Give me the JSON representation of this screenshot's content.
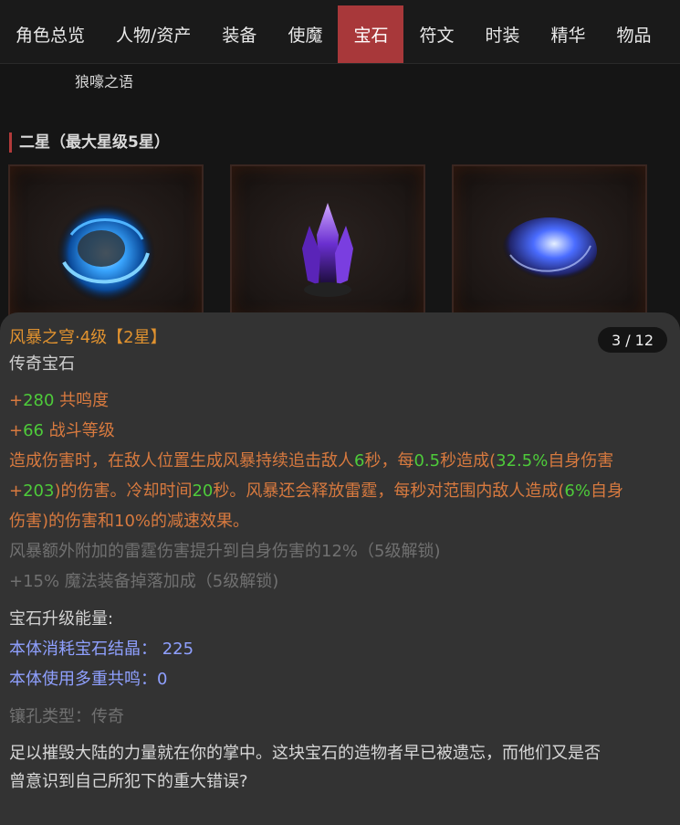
{
  "tabs": [
    "角色总览",
    "人物/资产",
    "装备",
    "使魔",
    "宝石",
    "符文",
    "时装",
    "精华",
    "物品"
  ],
  "active_tab": 4,
  "subname": "狼嚎之语",
  "section_title": "二星（最大星级5星）",
  "gem": {
    "title": "风暴之穹·4级【2星】",
    "type": "传奇宝石",
    "counter": "3 / 12",
    "stats": [
      {
        "plus": "+",
        "value": "280",
        "label": " 共鸣度"
      },
      {
        "plus": "+",
        "value": "66",
        "label": " 战斗等级"
      }
    ],
    "effect": {
      "l1a": "造成伤害时，在敌人位置生成风暴持续追击敌人",
      "l1b": "6",
      "l1c": "秒，每",
      "l1d": "0.5",
      "l1e": "秒造成(",
      "l1f": "32.5%",
      "l1g": "自身伤害",
      "l2a": "+",
      "l2b": "203",
      "l2c": ")的伤害。冷却时间",
      "l2d": "20",
      "l2e": "秒。风暴还会释放雷霆，每秒对范围内敌人造成(",
      "l2f": "6%",
      "l2g": "自身",
      "l3": "伤害)的伤害和10%的减速效果。"
    },
    "locked1": "风暴额外附加的雷霆伤害提升到自身伤害的12%（5级解锁)",
    "locked2": "+15% 魔法装备掉落加成（5级解锁)",
    "upgrade_title": "宝石升级能量:",
    "upgrade_consume": "本体消耗宝石结晶： 225",
    "upgrade_resonance": "本体使用多重共鸣：0",
    "socket": "镶孔类型：传奇",
    "flavor1": "足以摧毁大陆的力量就在你的掌中。这块宝石的造物者早已被遗忘，而他们又是否",
    "flavor2": "曾意识到自己所犯下的重大错误?"
  }
}
